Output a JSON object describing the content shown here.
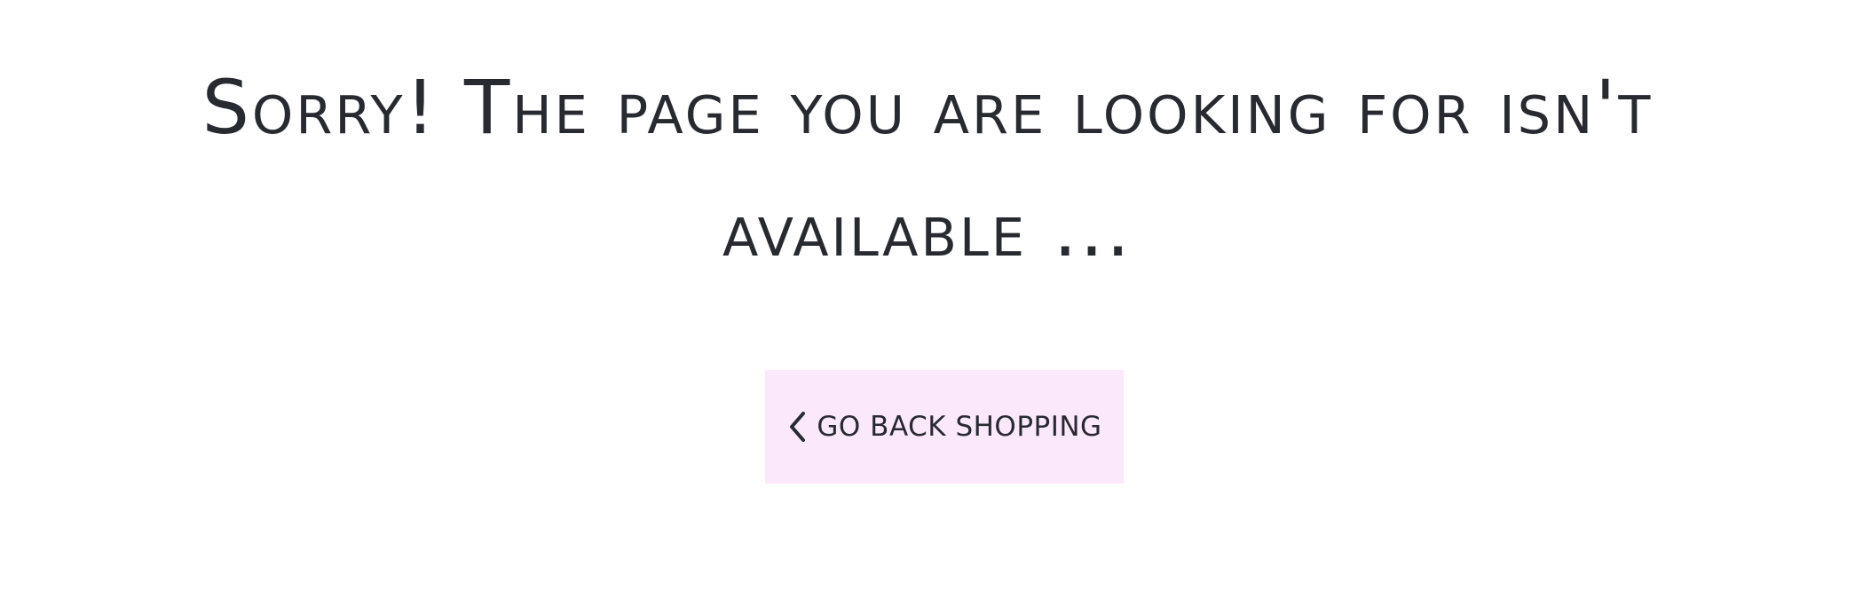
{
  "error": {
    "message": "Sorry! The page you are looking for isn't available ..."
  },
  "actions": {
    "back_label": "GO BACK SHOPPING",
    "back_icon": "chevron-left-icon"
  },
  "colors": {
    "text": "#272a30",
    "button_bg": "#fbe9fb",
    "background": "#ffffff"
  }
}
